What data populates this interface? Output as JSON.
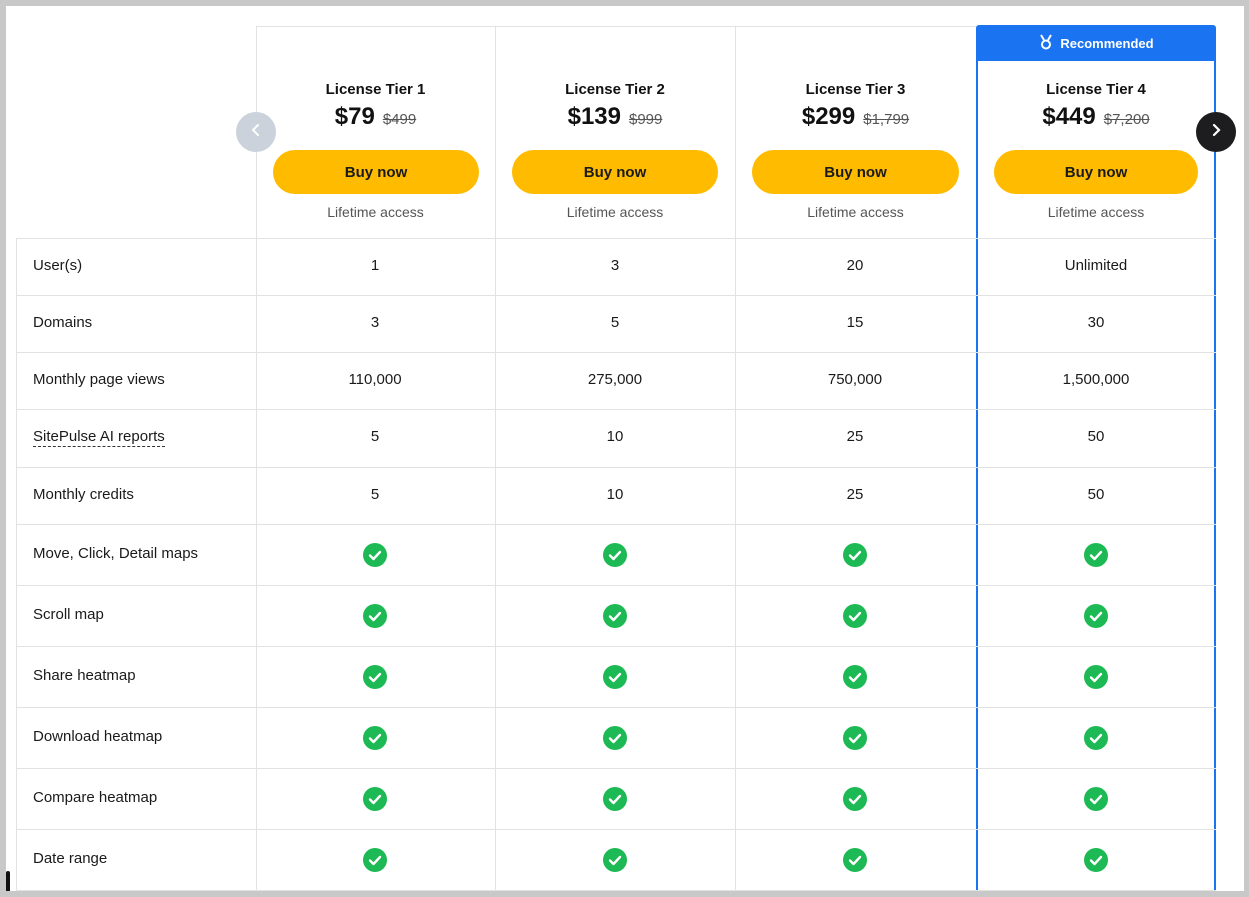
{
  "recommended_label": "Recommended",
  "tiers": [
    {
      "name": "License Tier 1",
      "price": "$79",
      "old_price": "$499",
      "buy_label": "Buy now",
      "access": "Lifetime access"
    },
    {
      "name": "License Tier 2",
      "price": "$139",
      "old_price": "$999",
      "buy_label": "Buy now",
      "access": "Lifetime access"
    },
    {
      "name": "License Tier 3",
      "price": "$299",
      "old_price": "$1,799",
      "buy_label": "Buy now",
      "access": "Lifetime access"
    },
    {
      "name": "License Tier 4",
      "price": "$449",
      "old_price": "$7,200",
      "buy_label": "Buy now",
      "access": "Lifetime access"
    }
  ],
  "features": [
    {
      "label": "User(s)",
      "values": [
        "1",
        "3",
        "20",
        "Unlimited"
      ]
    },
    {
      "label": "Domains",
      "values": [
        "3",
        "5",
        "15",
        "30"
      ]
    },
    {
      "label": "Monthly page views",
      "values": [
        "110,000",
        "275,000",
        "750,000",
        "1,500,000"
      ]
    },
    {
      "label": "SitePulse AI reports",
      "values": [
        "5",
        "10",
        "25",
        "50"
      ]
    },
    {
      "label": "Monthly credits",
      "values": [
        "5",
        "10",
        "25",
        "50"
      ]
    },
    {
      "label": "Move, Click, Detail maps",
      "values": [
        "check",
        "check",
        "check",
        "check"
      ]
    },
    {
      "label": "Scroll map",
      "values": [
        "check",
        "check",
        "check",
        "check"
      ]
    },
    {
      "label": "Share heatmap",
      "values": [
        "check",
        "check",
        "check",
        "check"
      ]
    },
    {
      "label": "Download heatmap",
      "values": [
        "check",
        "check",
        "check",
        "check"
      ]
    },
    {
      "label": "Compare heatmap",
      "values": [
        "check",
        "check",
        "check",
        "check"
      ]
    },
    {
      "label": "Date range",
      "values": [
        "check",
        "check",
        "check",
        "check"
      ]
    }
  ],
  "icons": {
    "prev": "chevron-left-icon",
    "next": "chevron-right-icon",
    "badge": "medal-icon",
    "check": "check-circle-icon"
  },
  "colors": {
    "accent": "#1a73f0",
    "button": "#ffbb00",
    "check": "#1db954"
  }
}
